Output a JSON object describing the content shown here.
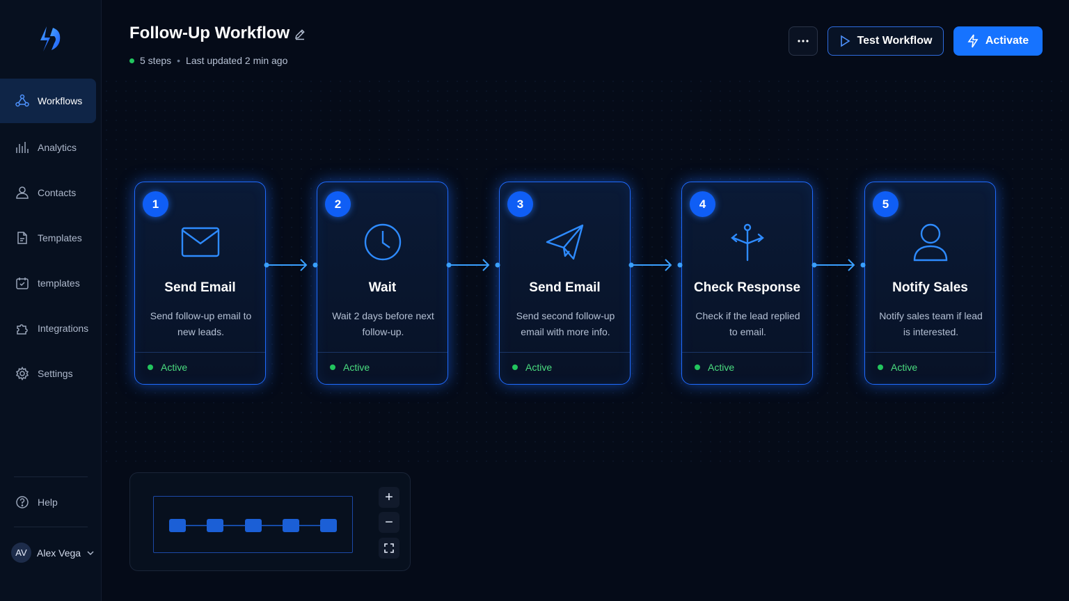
{
  "header": {
    "title": "Follow-Up Workflow",
    "steps": "5 steps",
    "updated": "Last updated 2 min ago",
    "more_icon": "more-horizontal-icon",
    "test_label": "Test Workflow",
    "activate_label": "Activate"
  },
  "sidebar": {
    "items": [
      {
        "label": "Workflows",
        "icon": "workflow-icon",
        "active": true
      },
      {
        "label": "Analytics",
        "icon": "bar-chart-icon"
      },
      {
        "label": "Contacts",
        "icon": "user-icon"
      },
      {
        "label": "Templates",
        "icon": "document-icon"
      },
      {
        "label": "templates",
        "icon": "template-icon"
      },
      {
        "label": "Integrations",
        "icon": "puzzle-icon"
      },
      {
        "label": "Settings",
        "icon": "gear-icon"
      }
    ],
    "help": "Help",
    "user": {
      "initials": "AV",
      "name": "Alex Vega"
    }
  },
  "workflow": {
    "steps": [
      {
        "number": "1",
        "title": "Send Email",
        "description": "Send follow-up email to new leads.",
        "status": "Active",
        "icon": "mail-icon"
      },
      {
        "number": "2",
        "title": "Wait",
        "description": "Wait 2 days before next follow-up.",
        "status": "Active",
        "icon": "clock-icon"
      },
      {
        "number": "3",
        "title": "Send Email",
        "description": "Send second follow-up email with more info.",
        "status": "Active",
        "icon": "send-icon"
      },
      {
        "number": "4",
        "title": "Check Response",
        "description": "Check if the lead replied to email.",
        "status": "Active",
        "icon": "branch-icon"
      },
      {
        "number": "5",
        "title": "Notify Sales",
        "description": "Notify sales team if lead is interested.",
        "status": "Active",
        "icon": "user-icon"
      }
    ]
  },
  "minimap": {
    "zoom_in": "+",
    "zoom_out": "−"
  },
  "colors": {
    "accent": "#1673ff",
    "status_active": "#4ade80",
    "background": "#050b18"
  }
}
